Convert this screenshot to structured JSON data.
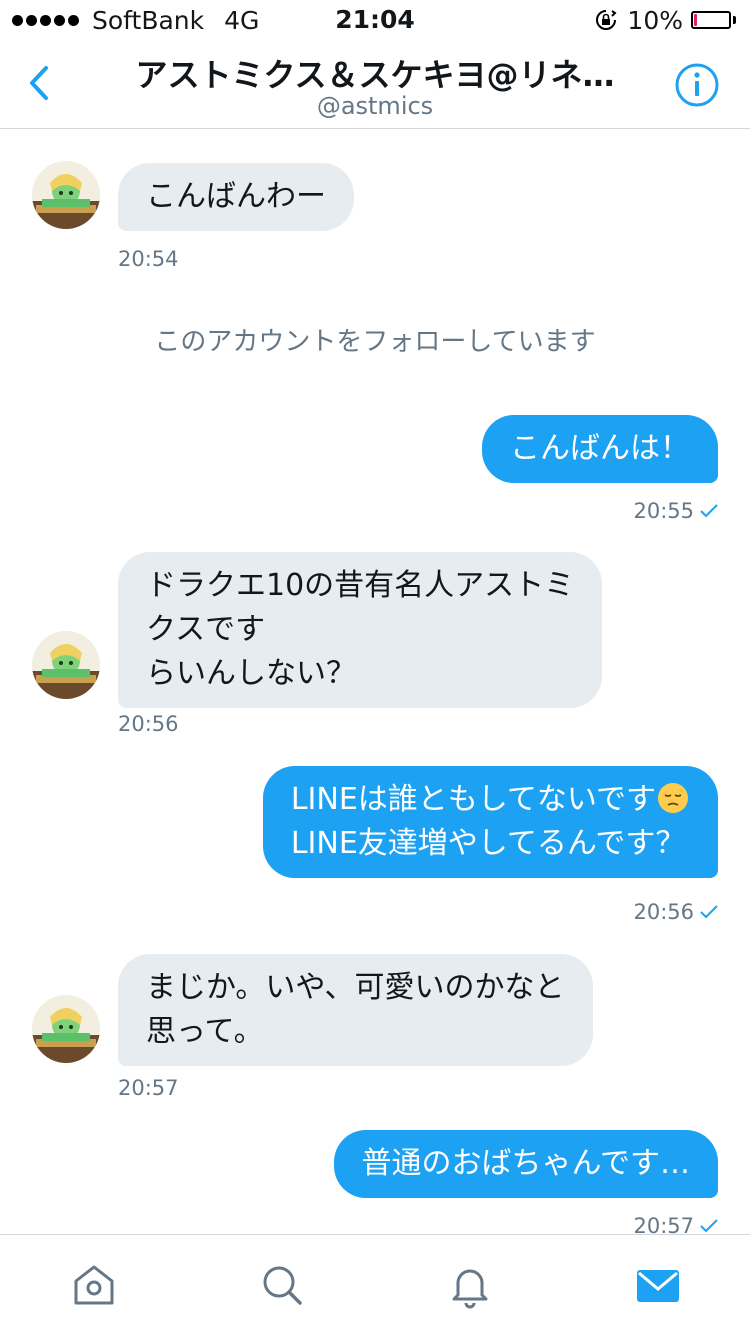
{
  "status_bar": {
    "carrier": "SoftBank",
    "network": "4G",
    "time": "21:04",
    "battery": "10%",
    "battery_level": 0.1
  },
  "nav": {
    "title": "アストミクス＆スケキヨ@リネ…",
    "handle": "@astmics"
  },
  "messages": {
    "m1": {
      "lines": [
        "こんばんわー"
      ],
      "time": "20:54"
    },
    "system": "このアカウントをフォローしています",
    "m2": {
      "lines": [
        "こんばんは！"
      ],
      "time": "20:55"
    },
    "m3": {
      "lines": [
        "ドラクエ10の昔有名人アストミ",
        "クスです",
        "らいんしない？"
      ],
      "time": "20:56"
    },
    "m4": {
      "lines": [
        "LINEは誰ともしてないです",
        "LINE友達増やしてるんです？"
      ],
      "time": "20:56"
    },
    "m5": {
      "lines": [
        "まじか。いや、可愛いのかなと",
        "思って。"
      ],
      "time": "20:57"
    },
    "m6": {
      "lines": [
        "普通のおばちゃんです…"
      ],
      "time": "20:57"
    }
  },
  "tabs": [
    "home-icon",
    "search-icon",
    "notifications-icon",
    "messages-icon"
  ],
  "colors": {
    "accent": "#1da1f2",
    "bubble_in": "#e6ecf0",
    "muted": "#657786"
  }
}
